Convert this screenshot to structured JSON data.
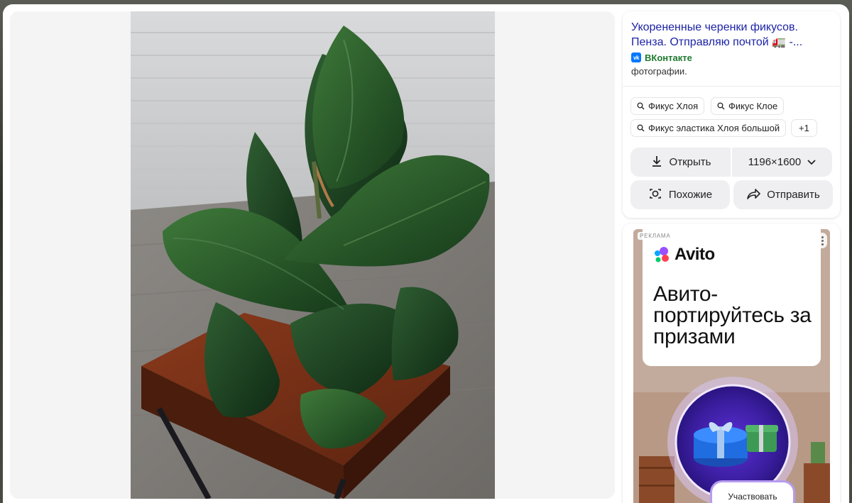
{
  "result": {
    "title": "Укорененные черенки фикусов. Пенза. Отправляю почтой 🚛 -...",
    "source_name": "ВКонтакте",
    "source_icon": "vk-icon",
    "description": "фотографии."
  },
  "tags": [
    "Фикус Хлоя",
    "Фикус Клое",
    "Фикус эластика Хлоя большой"
  ],
  "tags_more": "+1",
  "actions": {
    "open_label": "Открыть",
    "size_label": "1196×1600",
    "similar_label": "Похожие",
    "share_label": "Отправить"
  },
  "ad": {
    "label": "РЕКЛАМА",
    "brand": "Avito",
    "headline": "Авито-портируйтесь за призами",
    "cta": "Участвовать"
  },
  "colors": {
    "title_link": "#1d23a6",
    "source_green": "#1e7a2e",
    "vk_blue": "#0077ff",
    "button_bg": "#efeff1"
  }
}
